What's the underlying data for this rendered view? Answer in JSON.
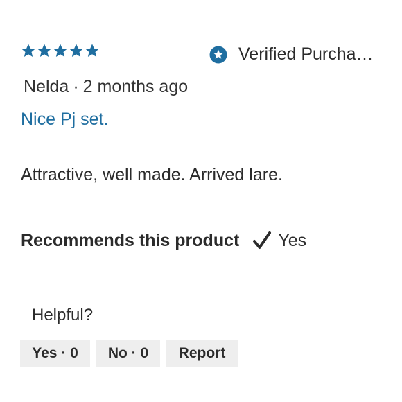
{
  "review": {
    "rating": 5,
    "rating_max": 5,
    "star_color": "#1f6ea0",
    "verified_icon": "star-badge-icon",
    "verified_label": "Verified Purcha…",
    "author": "Nelda",
    "separator": "·",
    "date": "2 months ago",
    "title": "Nice Pj set.",
    "body": "Attractive, well made. Arrived lare.",
    "recommend_label": "Recommends this product",
    "recommend_icon": "checkmark-icon",
    "recommend_value": "Yes"
  },
  "feedback": {
    "prompt": "Helpful?",
    "yes_label": "Yes · 0",
    "no_label": "No · 0",
    "report_label": "Report"
  },
  "colors": {
    "accent": "#1f6ea0",
    "text": "#2b2b2b",
    "button_bg": "#eeeeee"
  }
}
